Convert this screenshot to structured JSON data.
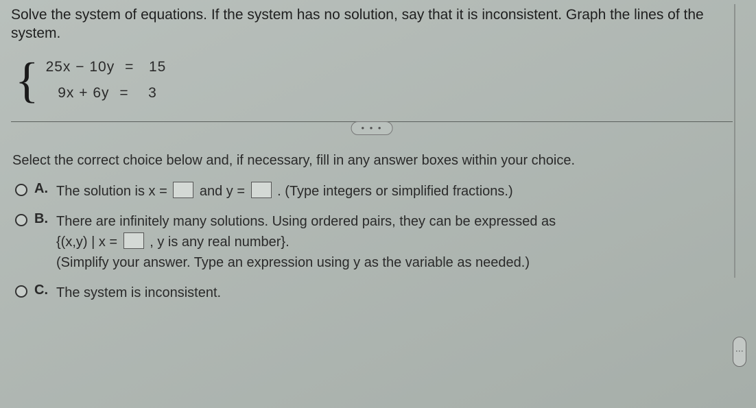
{
  "instructions": "Solve the system of equations. If the system has no solution, say that it is inconsistent. Graph the lines of the system.",
  "system": {
    "line1": {
      "lhs": "25x  −  10y",
      "op": "=",
      "rhs": "15"
    },
    "line2": {
      "lhs": "9x  +   6y",
      "op": "=",
      "rhs": "3"
    }
  },
  "divider_dots": "• • •",
  "prompt2": "Select the correct choice below and, if necessary, fill in any answer boxes within your choice.",
  "choices": {
    "A": {
      "letter": "A.",
      "pre": "The solution is x =",
      "mid": "and y =",
      "post": ". (Type integers or simplified fractions.)"
    },
    "B": {
      "letter": "B.",
      "line1": "There are infinitely many solutions. Using ordered pairs, they can be expressed as",
      "set_pre": "{(x,y) | x =",
      "set_post": ", y is any real number}.",
      "line3": "(Simplify your answer. Type an expression using y as the variable as needed.)"
    },
    "C": {
      "letter": "C.",
      "text": "The system is inconsistent."
    }
  },
  "vdots": "⋮"
}
